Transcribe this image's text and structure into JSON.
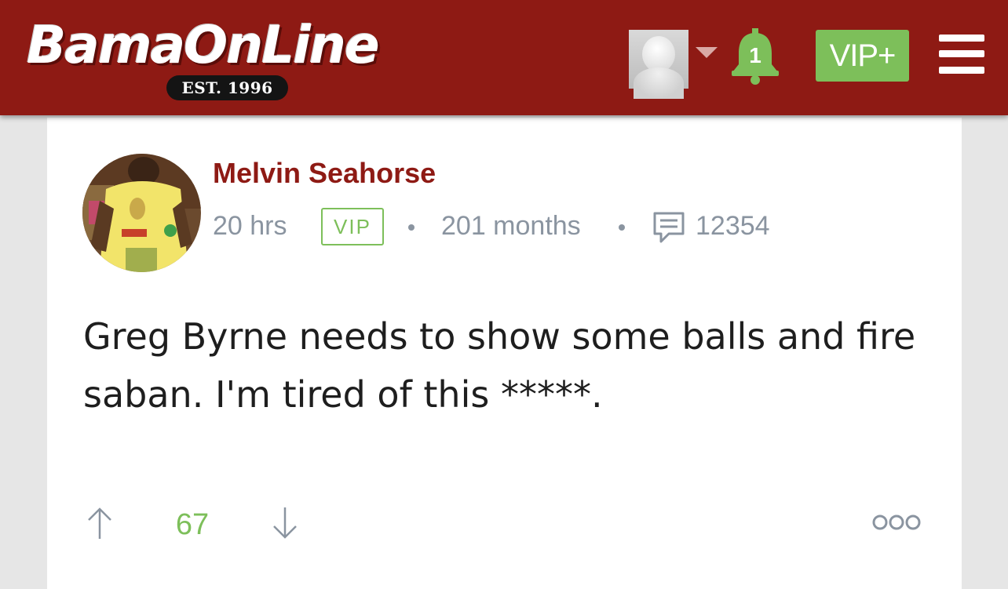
{
  "header": {
    "logo_text": "BamaOnLine",
    "logo_tagline": "EST. 1996",
    "notification_count": "1",
    "vip_button_label": "VIP+",
    "colors": {
      "header_bg": "#8e1a14",
      "accent_green": "#7dbf5a"
    },
    "icons": [
      "user-avatar",
      "chevron-down-icon",
      "bell-icon",
      "menu-icon"
    ]
  },
  "post": {
    "author": "Melvin Seahorse",
    "time_ago": "20 hrs",
    "badge": "VIP",
    "membership": "201 months",
    "post_count": "12354",
    "body": "Greg Byrne needs to show some balls and fire saban. I'm tired of this *****.",
    "votes": "67",
    "icons": [
      "comment-icon",
      "arrow-up-icon",
      "arrow-down-icon",
      "more-icon"
    ]
  }
}
